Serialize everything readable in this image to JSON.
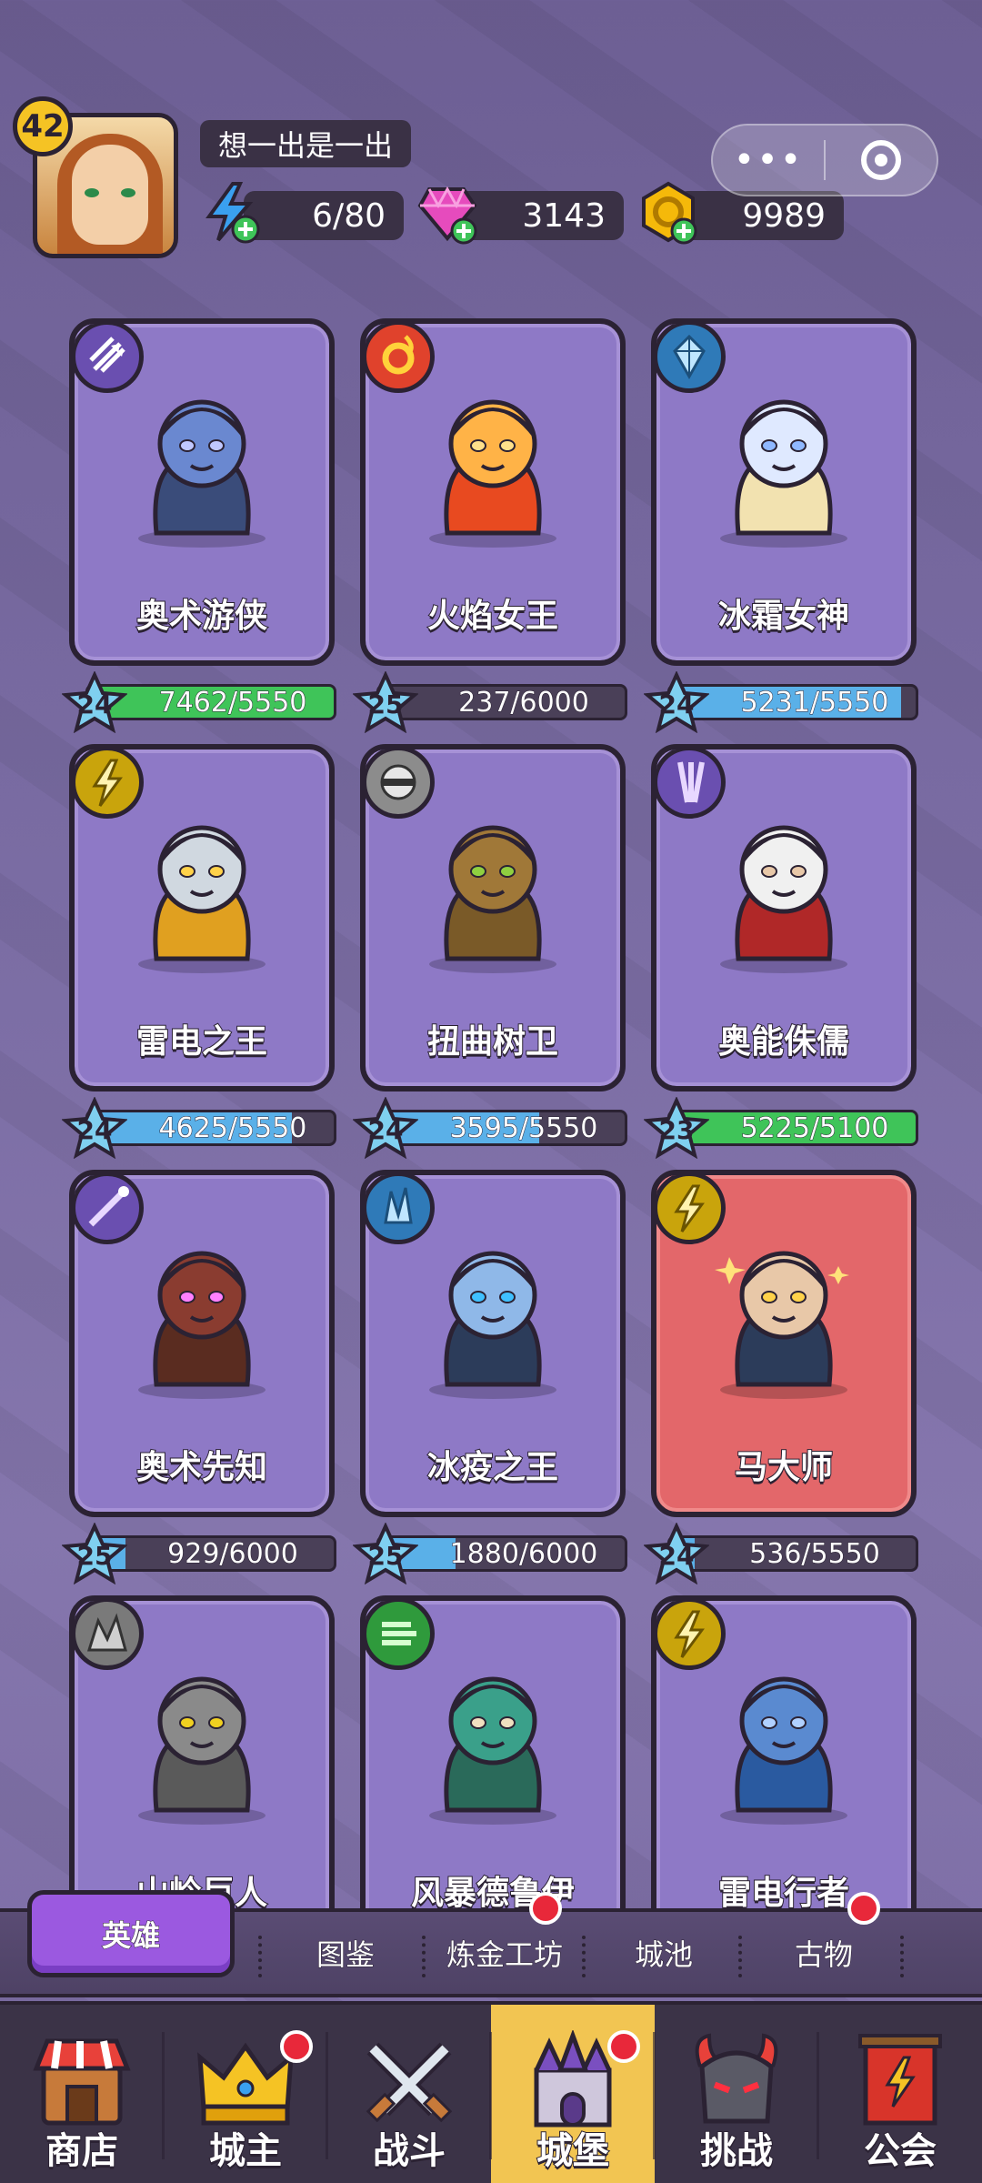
{
  "player": {
    "level": "42",
    "name": "想一出是一出"
  },
  "resources": {
    "energy": "6/80",
    "gems": "3143",
    "gold": "9989"
  },
  "capsule": {
    "more_icon": "more-dots-icon",
    "close_icon": "target-circle-icon"
  },
  "heroes": [
    {
      "name": "奥术游侠",
      "star_level": "24",
      "progress": "7462/5550",
      "progress_fraction": 1.0,
      "bar_color": "#3fc459",
      "card_color": "purple",
      "class_icon": "arrows-icon"
    },
    {
      "name": "火焰女王",
      "star_level": "25",
      "progress": "237/6000",
      "progress_fraction": 0.04,
      "bar_color": "#5ab0e8",
      "card_color": "purple",
      "class_icon": "fire-ring-icon"
    },
    {
      "name": "冰霜女神",
      "star_level": "24",
      "progress": "5231/5550",
      "progress_fraction": 0.94,
      "bar_color": "#5ab0e8",
      "card_color": "purple",
      "class_icon": "ice-crystal-icon"
    },
    {
      "name": "雷电之王",
      "star_level": "24",
      "progress": "4625/5550",
      "progress_fraction": 0.83,
      "bar_color": "#5ab0e8",
      "card_color": "purple",
      "class_icon": "lightning-icon"
    },
    {
      "name": "扭曲树卫",
      "star_level": "24",
      "progress": "3595/5550",
      "progress_fraction": 0.65,
      "bar_color": "#5ab0e8",
      "card_color": "purple",
      "class_icon": "shield-orb-icon"
    },
    {
      "name": "奥能侏儒",
      "star_level": "23",
      "progress": "5225/5100",
      "progress_fraction": 1.0,
      "bar_color": "#3fc459",
      "card_color": "purple",
      "class_icon": "arcane-beam-icon"
    },
    {
      "name": "奥术先知",
      "star_level": "25",
      "progress": "929/6000",
      "progress_fraction": 0.15,
      "bar_color": "#5ab0e8",
      "card_color": "purple",
      "class_icon": "arcane-staff-icon"
    },
    {
      "name": "冰疫之王",
      "star_level": "25",
      "progress": "1880/6000",
      "progress_fraction": 0.31,
      "bar_color": "#5ab0e8",
      "card_color": "purple",
      "class_icon": "ice-shard-icon"
    },
    {
      "name": "马大师",
      "star_level": "24",
      "progress": "536/5550",
      "progress_fraction": 0.1,
      "bar_color": "#5ab0e8",
      "card_color": "red",
      "class_icon": "lightning-icon"
    },
    {
      "name": "山岭巨人",
      "class_icon": "rock-icon"
    },
    {
      "name": "风暴德鲁伊",
      "class_icon": "wind-icon"
    },
    {
      "name": "雷电行者",
      "class_icon": "lightning-icon"
    }
  ],
  "subtabs": [
    "英雄",
    "图鉴",
    "炼金工坊",
    "城池",
    "古物"
  ],
  "nav": [
    {
      "label": "商店",
      "icon": "shop-icon"
    },
    {
      "label": "城主",
      "icon": "crown-icon"
    },
    {
      "label": "战斗",
      "icon": "crossed-swords-icon"
    },
    {
      "label": "城堡",
      "icon": "castle-icon"
    },
    {
      "label": "挑战",
      "icon": "demon-helmet-icon"
    },
    {
      "label": "公会",
      "icon": "guild-banner-icon"
    }
  ],
  "colors": {
    "accent": "#9b59e0",
    "nav_active": "#f2c552",
    "notification": "#e8283a",
    "card_purple": "#8e79c6",
    "card_red": "#e3676a"
  }
}
